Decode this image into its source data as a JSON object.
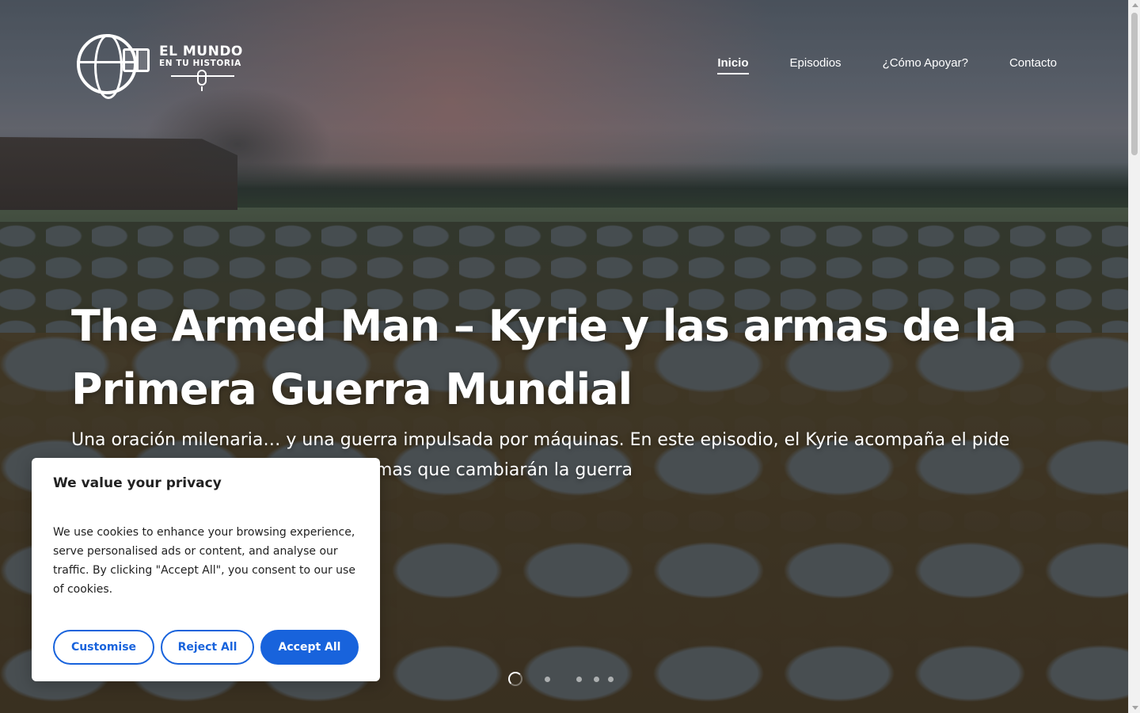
{
  "header": {
    "logo": {
      "line1": "EL MUNDO",
      "line2": "EN TU HISTORIA"
    },
    "nav": [
      {
        "label": "Inicio",
        "active": true
      },
      {
        "label": "Episodios",
        "active": false
      },
      {
        "label": "¿Cómo Apoyar?",
        "active": false
      },
      {
        "label": "Contacto",
        "active": false
      }
    ]
  },
  "hero": {
    "title": "The Armed Man – Kyrie y las armas de la Primera Guerra Mundial",
    "subtitle": "Una oración milenaria… y una guerra impulsada por máquinas. En este episodio, el Kyrie acompaña el pide misericordia… mientras crea las armas que cambiarán la guerra",
    "slider": {
      "slides": 4,
      "current": 1
    }
  },
  "cookie_banner": {
    "title": "We value your privacy",
    "text": "We use cookies to enhance your browsing experience, serve personalised ads or content, and analyse our traffic. By clicking \"Accept All\", you consent to our use of cookies.",
    "customise_label": "Customise",
    "reject_label": "Reject All",
    "accept_label": "Accept All",
    "accent_color": "#1863dc"
  }
}
